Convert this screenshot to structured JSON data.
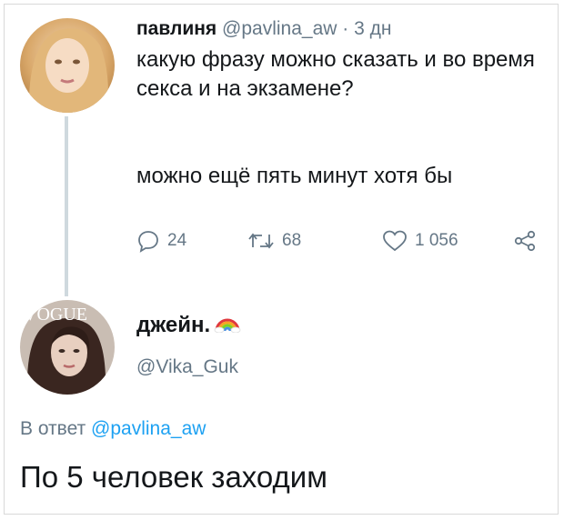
{
  "tweet": {
    "author_name": "павлиня",
    "author_handle": "@pavlina_aw",
    "separator": "·",
    "time": "3 дн",
    "text_line1": "какую фразу можно сказать и во время секса и на экзамене?",
    "text_line2": "можно ещё пять минут хотя бы",
    "replies": "24",
    "retweets": "68",
    "likes": "1 056",
    "icons": [
      "reply-icon",
      "retweet-icon",
      "like-icon",
      "share-icon"
    ]
  },
  "reply": {
    "author_name": "джейн.",
    "author_emoji": "rainbow",
    "author_handle": "@Vika_Guk",
    "avatar_overlay_text": "VOGUE",
    "reply_to_prefix": "В ответ",
    "reply_to_handle": "@pavlina_aw",
    "text": "По 5 человек заходим"
  },
  "colors": {
    "text": "#14171a",
    "muted": "#657786",
    "link": "#1da1f2",
    "thread_line": "#cfd9de"
  }
}
